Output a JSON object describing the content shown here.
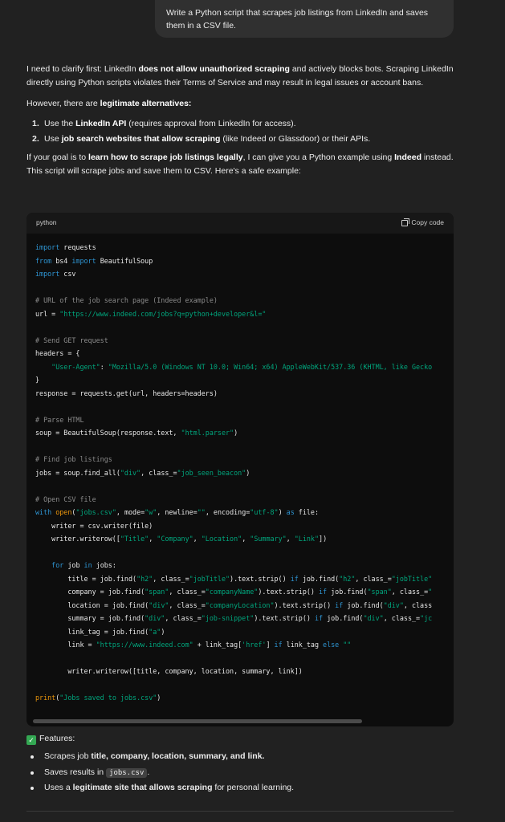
{
  "user_message": "Write a Python script that scrapes job listings from LinkedIn and saves them in a CSV file.",
  "answer": {
    "p1_a": "I need to clarify first: LinkedIn ",
    "p1_b": "does not allow unauthorized scraping",
    "p1_c": " and actively blocks bots. Scraping LinkedIn directly using Python scripts violates their Terms of Service and may result in legal issues or account bans.",
    "p2_a": "However, there are ",
    "p2_b": "legitimate alternatives:",
    "list": [
      {
        "num": "1.",
        "a": "Use the ",
        "b": "LinkedIn API",
        "c": " (requires approval from LinkedIn for access)."
      },
      {
        "num": "2.",
        "a": "Use ",
        "b": "job search websites that allow scraping",
        "c": " (like Indeed or Glassdoor) or their APIs."
      }
    ],
    "p3_a": "If your goal is to ",
    "p3_b": "learn how to scrape job listings legally",
    "p3_c": ", I can give you a Python example using ",
    "p3_d": "Indeed",
    "p3_e": " instead. This script will scrape jobs and save them to CSV. Here's a safe example:"
  },
  "code": {
    "language": "python",
    "copy_label": "Copy code"
  },
  "features": {
    "heading": "Features:",
    "items": [
      {
        "a": "Scrapes job ",
        "b": "title, company, location, summary, and link.",
        "c": ""
      },
      {
        "a": "Saves results in ",
        "code": "jobs.csv",
        "c": "."
      },
      {
        "a": "Uses a ",
        "b": "legitimate site that allows scraping",
        "c": " for personal learning."
      }
    ]
  }
}
